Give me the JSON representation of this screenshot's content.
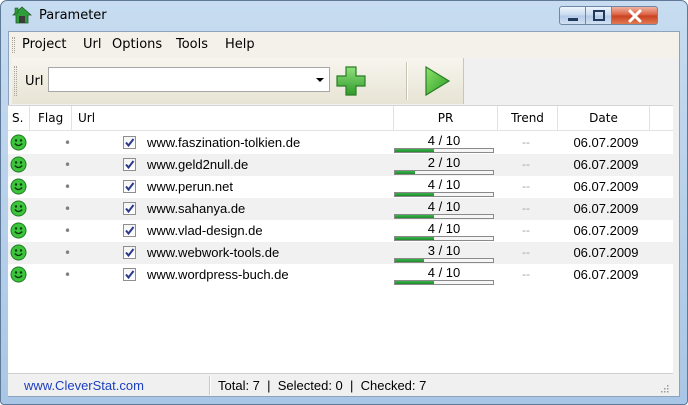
{
  "window": {
    "title": "Parameter",
    "icons": {
      "app": "house-icon",
      "minimize": "minimize-icon",
      "maximize": "maximize-icon",
      "close": "close-icon"
    }
  },
  "menu": {
    "items": [
      "Project",
      "Url",
      "Options",
      "Tools",
      "Help"
    ]
  },
  "toolbar": {
    "url_label": "Url",
    "url_value": "",
    "add_icon": "plus-icon",
    "run_icon": "play-icon"
  },
  "table": {
    "columns": [
      "S.",
      "Flag",
      "Url",
      "PR",
      "Trend",
      "Date"
    ],
    "rows": [
      {
        "status": "ok-smiley-icon",
        "flag": "•",
        "checked": true,
        "url": "www.faszination-tolkien.de",
        "pr": "4 / 10",
        "pr_value": 4,
        "trend": "--",
        "date": "06.07.2009"
      },
      {
        "status": "ok-smiley-icon",
        "flag": "•",
        "checked": true,
        "url": "www.geld2null.de",
        "pr": "2 / 10",
        "pr_value": 2,
        "trend": "--",
        "date": "06.07.2009"
      },
      {
        "status": "ok-smiley-icon",
        "flag": "•",
        "checked": true,
        "url": "www.perun.net",
        "pr": "4 / 10",
        "pr_value": 4,
        "trend": "--",
        "date": "06.07.2009"
      },
      {
        "status": "ok-smiley-icon",
        "flag": "•",
        "checked": true,
        "url": "www.sahanya.de",
        "pr": "4 / 10",
        "pr_value": 4,
        "trend": "--",
        "date": "06.07.2009"
      },
      {
        "status": "ok-smiley-icon",
        "flag": "•",
        "checked": true,
        "url": "www.vlad-design.de",
        "pr": "4 / 10",
        "pr_value": 4,
        "trend": "--",
        "date": "06.07.2009"
      },
      {
        "status": "ok-smiley-icon",
        "flag": "•",
        "checked": true,
        "url": "www.webwork-tools.de",
        "pr": "3 / 10",
        "pr_value": 3,
        "trend": "--",
        "date": "06.07.2009"
      },
      {
        "status": "ok-smiley-icon",
        "flag": "•",
        "checked": true,
        "url": "www.wordpress-buch.de",
        "pr": "4 / 10",
        "pr_value": 4,
        "trend": "--",
        "date": "06.07.2009"
      }
    ]
  },
  "statusbar": {
    "link": "www.CleverStat.com",
    "stats": "Total: 7  |  Selected: 0  |  Checked: 7"
  },
  "colors": {
    "pr_fill": "#2a9e38",
    "status_green": "#3cc43c",
    "link": "#1c3fbf"
  }
}
